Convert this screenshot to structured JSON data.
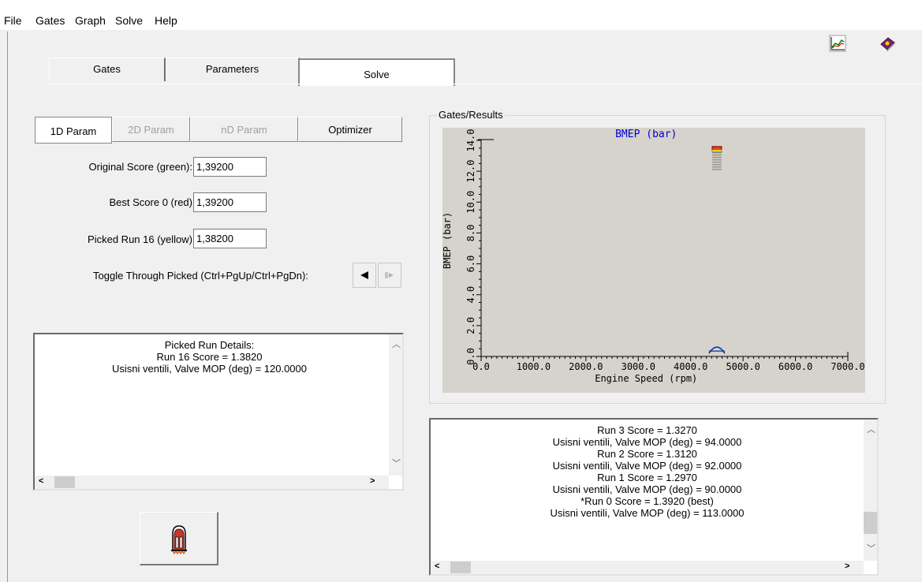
{
  "menu": [
    "File",
    "Gates",
    "Graph",
    "Solve",
    "Help"
  ],
  "toolbar": {
    "graph_icon": "graph-icon",
    "help_icon": "help-book-icon"
  },
  "tabs": [
    {
      "label": "Gates",
      "active": false
    },
    {
      "label": "Parameters",
      "active": false
    },
    {
      "label": "Solve",
      "active": true
    }
  ],
  "sub_tabs": [
    {
      "label": "1D Param",
      "state": "active"
    },
    {
      "label": "2D Param",
      "state": "disabled"
    },
    {
      "label": "nD Param",
      "state": "disabled"
    },
    {
      "label": "Optimizer",
      "state": "enabled"
    }
  ],
  "scores": {
    "original_label": "Original Score (green):",
    "original_value": "1,39200",
    "best_label": "Best Score 0 (red)",
    "best_value": "1,39200",
    "picked_label": "Picked Run 16 (yellow)",
    "picked_value": "1,38200"
  },
  "toggle": {
    "label": "Toggle Through Picked (Ctrl+PgUp/Ctrl+PgDn):",
    "prev_icon": "triangle-left-icon",
    "next_icon": "triangle-right-icon"
  },
  "details": {
    "lines": [
      "Picked Run Details:",
      "Run 16  Score = 1.3820",
      "Usisni ventili, Valve MOP (deg) = 120.0000"
    ]
  },
  "group_title": "Gates/Results",
  "chart_data": {
    "type": "scatter",
    "title": "BMEP (bar)",
    "xlabel": "Engine Speed (rpm)",
    "ylabel": "BMEP (bar)",
    "xlim": [
      0,
      7000
    ],
    "ylim": [
      0,
      14
    ],
    "x_ticks": [
      "0.0",
      "1000.0",
      "2000.0",
      "3000.0",
      "4000.0",
      "5000.0",
      "6000.0",
      "7000.0"
    ],
    "y_ticks": [
      "0.0",
      "2.0",
      "4.0",
      "6.0",
      "8.0",
      "10.0",
      "12.0",
      "14.0"
    ],
    "grid": false,
    "marker_stack": {
      "x": 4500,
      "y_top": 13.6,
      "y_bottom": 12.0
    },
    "gate_marker": {
      "x": 4500,
      "y": 0.3
    }
  },
  "results": {
    "lines": [
      "Run 3  Score = 1.3270",
      "Usisni ventili, Valve MOP (deg) = 94.0000",
      "Run 2  Score = 1.3120",
      "Usisni ventili, Valve MOP (deg) = 92.0000",
      "Run 1  Score = 1.2970",
      "Usisni ventili, Valve MOP (deg) = 90.0000",
      "*Run 0  Score = 1.3920 (best)",
      "Usisni ventili, Valve MOP (deg) = 113.0000"
    ]
  },
  "solve_button_icon": "rocket-icon"
}
